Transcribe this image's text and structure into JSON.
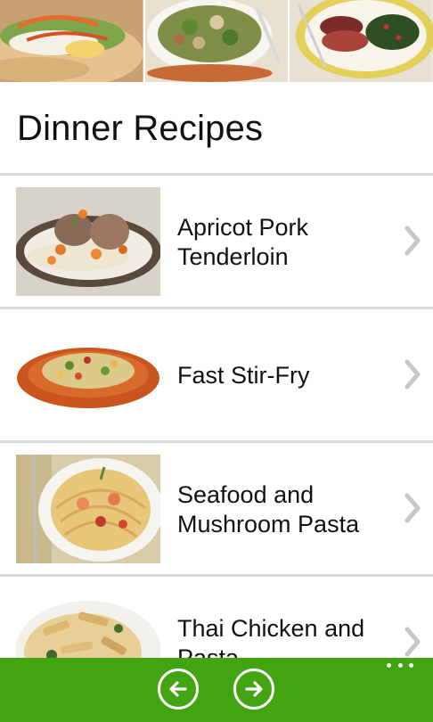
{
  "header": {
    "title": "Dinner Recipes",
    "banner_images": [
      "sandwich-photo",
      "salad-bowl-photo",
      "steak-plate-photo"
    ]
  },
  "recipes": [
    {
      "label": "Apricot Pork\nTenderloin",
      "image": "apricot-pork-photo"
    },
    {
      "label": "Fast Stir-Fry",
      "image": "stir-fry-photo"
    },
    {
      "label": "Seafood and\nMushroom Pasta",
      "image": "seafood-pasta-photo"
    },
    {
      "label": "Thai Chicken and\nPasta",
      "image": "thai-chicken-pasta-photo"
    }
  ],
  "app_bar": {
    "color": "#43a411",
    "buttons": [
      {
        "icon": "arrow-left-icon"
      },
      {
        "icon": "arrow-right-icon"
      }
    ],
    "more_icon": "ellipsis-icon"
  },
  "colors": {
    "divider": "#d9d9d9",
    "chevron": "#c8c8c8",
    "text": "#111111"
  }
}
